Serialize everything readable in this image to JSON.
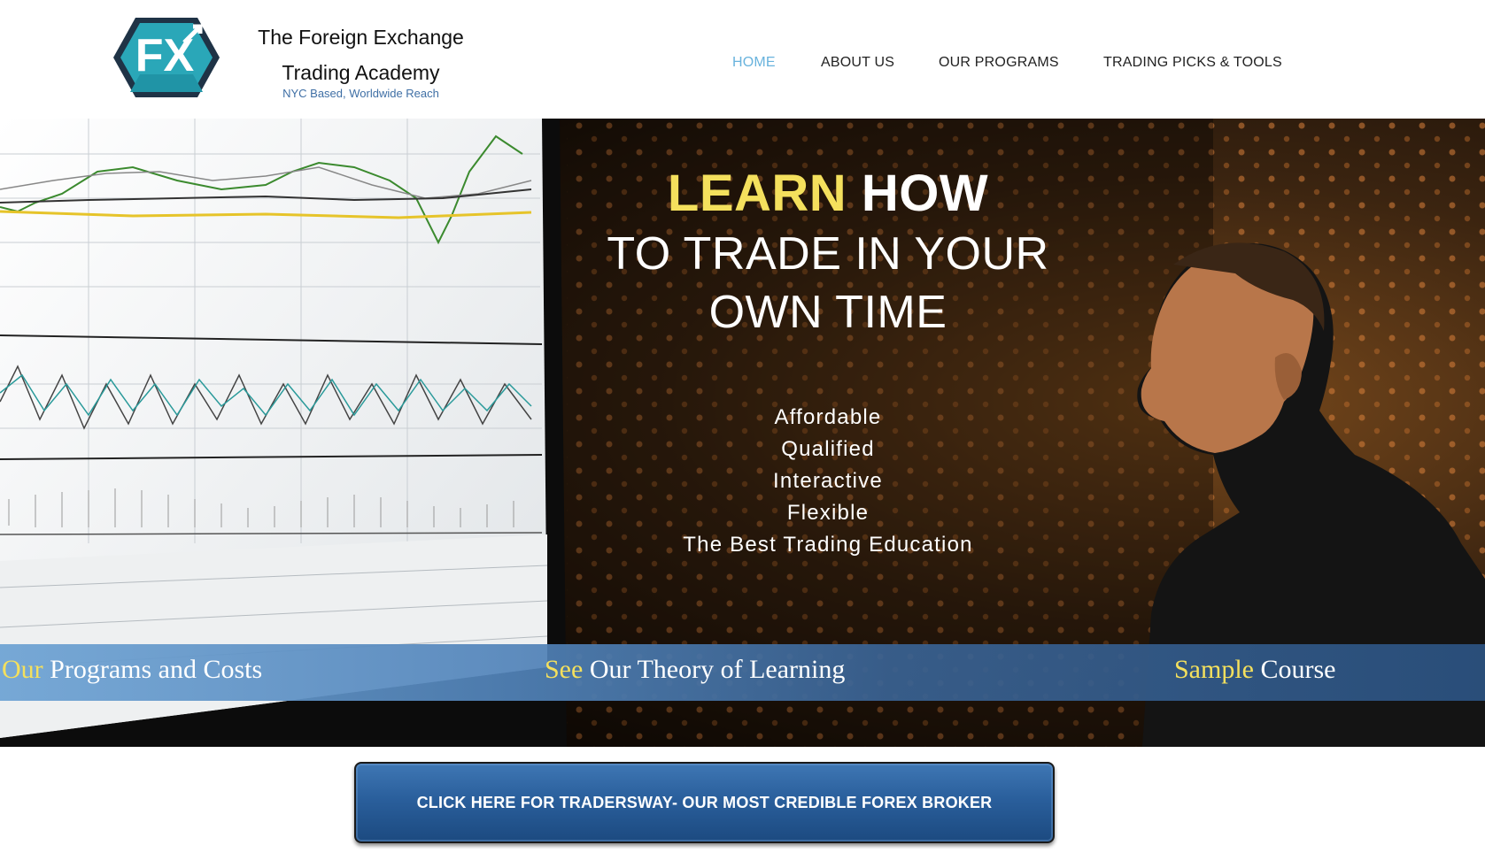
{
  "brand": {
    "logo_text": "FX",
    "title_line1": "The Foreign Exchange",
    "title_line2": "Trading Academy",
    "subtitle": "NYC Based, Worldwide Reach"
  },
  "nav": {
    "items": [
      {
        "label": "HOME",
        "active": true
      },
      {
        "label": "ABOUT US",
        "active": false
      },
      {
        "label": "OUR PROGRAMS",
        "active": false
      },
      {
        "label": "TRADING PICKS & TOOLS",
        "active": false
      }
    ]
  },
  "hero": {
    "headline_highlight": "LEARN",
    "headline_rest": " HOW",
    "subheadline_line1": "TO TRADE IN YOUR",
    "subheadline_line2": "OWN TIME",
    "features": [
      "Affordable",
      "Qualified",
      "Interactive",
      "Flexible",
      "The Best Trading Education"
    ]
  },
  "band_links": [
    {
      "highlight": "Our",
      "rest": " Programs and Costs"
    },
    {
      "highlight": "See",
      "rest": " Our Theory of Learning"
    },
    {
      "highlight": "Sample",
      "rest": " Course"
    }
  ],
  "cta": {
    "label": "CLICK HERE FOR TRADERSWAY- OUR MOST CREDIBLE FOREX BROKER"
  },
  "colors": {
    "accent_yellow": "#f4e05d",
    "nav_active": "#69b3dd",
    "logo_teal": "#2aa7b8",
    "logo_dark": "#1f3346",
    "cta_blue": "#2a5f9c"
  }
}
